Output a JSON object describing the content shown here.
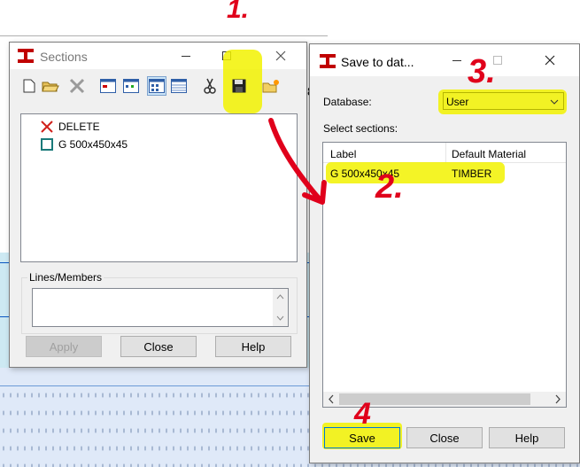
{
  "annotations": {
    "step1": "1.",
    "step2": "2.",
    "step3": "3.",
    "step4": "4"
  },
  "sections_dialog": {
    "title": "Sections",
    "toolbar_icons": [
      "new-icon",
      "open-folder-icon",
      "delete-x-icon",
      "window-icon-1",
      "window-icon-2",
      "window-icon-3",
      "table-icon",
      "scissors-icon",
      "save-disk-icon",
      "folder-star-icon"
    ],
    "items": [
      {
        "icon": "delete-x-icon",
        "label": "DELETE"
      },
      {
        "icon": "section-box-icon",
        "label": "G 500x450x45"
      }
    ],
    "lines_members_label": "Lines/Members",
    "buttons": {
      "apply": "Apply",
      "close": "Close",
      "help": "Help"
    }
  },
  "save_dialog": {
    "title": "Save to dat...",
    "database_label": "Database:",
    "database_value": "User",
    "select_sections_label": "Select sections:",
    "columns": [
      "Label",
      "Default Material"
    ],
    "rows": [
      {
        "label": "G 500x450x45",
        "material": "TIMBER"
      }
    ],
    "buttons": {
      "save": "Save",
      "close": "Close",
      "help": "Help"
    }
  },
  "colors": {
    "highlight": "#f2f200",
    "annotation": "#e0001b",
    "accent": "#0078d7"
  }
}
